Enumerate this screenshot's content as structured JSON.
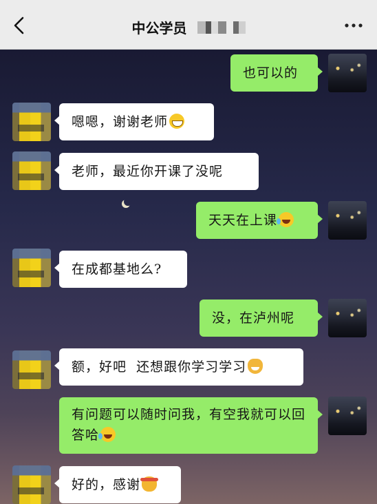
{
  "header": {
    "title": "中公学员"
  },
  "messages": [
    {
      "side": "right",
      "text": "也可以的"
    },
    {
      "side": "left",
      "text": "嗯嗯，谢谢老师",
      "emoji": "grin-emoji"
    },
    {
      "side": "left",
      "text": "老师，最近你开课了没呢"
    },
    {
      "side": "right",
      "text": "天天在上课",
      "emoji": "laugh-cry-emoji"
    },
    {
      "side": "left",
      "text": "在成都基地么?"
    },
    {
      "side": "right",
      "text": "没，在泸州呢"
    },
    {
      "side": "left",
      "text": "额，好吧  还想跟你学习学习",
      "emoji": "cat-emoji"
    },
    {
      "side": "right",
      "text": "有问题可以随时问我，有空我就可以回答哈",
      "emoji": "laugh-cry-emoji"
    },
    {
      "side": "left",
      "text": "好的，感谢",
      "emoji": "headband-emoji"
    }
  ],
  "colors": {
    "header_bg": "#ececec",
    "bubble_sent": "#95ec69",
    "bubble_received": "#ffffff"
  },
  "icons": [
    "back-arrow-icon",
    "more-options-icon"
  ]
}
